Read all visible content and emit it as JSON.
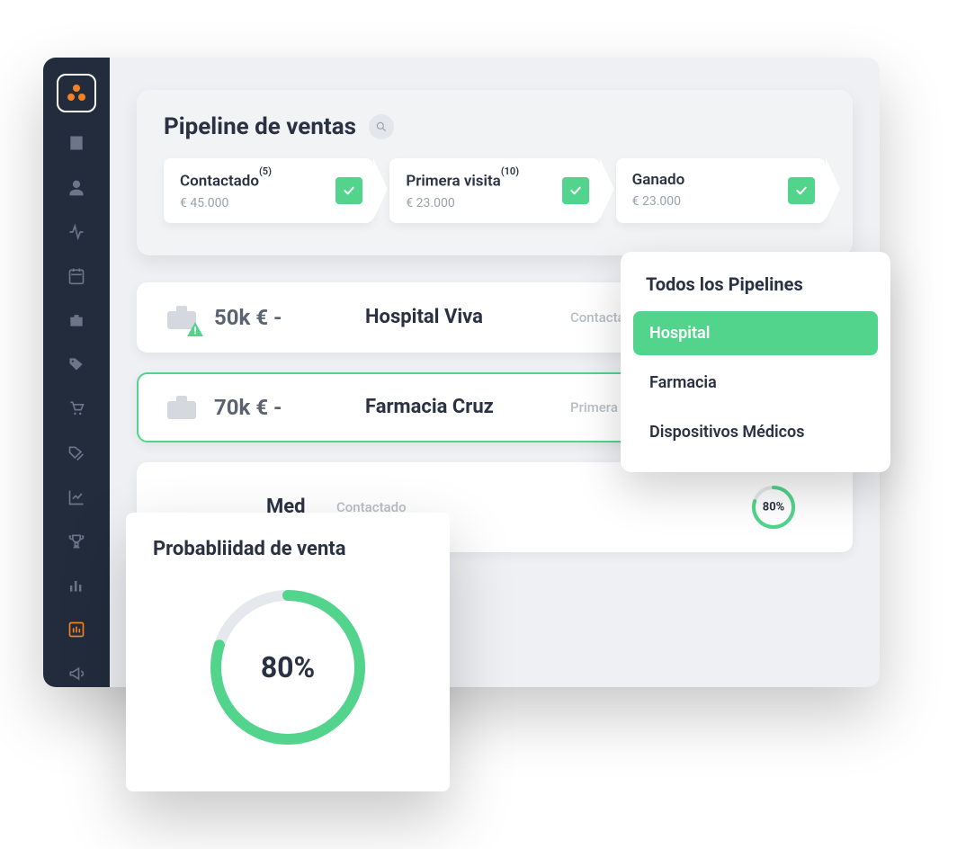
{
  "pipeline": {
    "title": "Pipeline de ventas",
    "stages": [
      {
        "label": "Contactado",
        "sup": "(5)",
        "amount": "€ 45.000"
      },
      {
        "label": "Primera visita",
        "sup": "(10)",
        "amount": "€ 23.000"
      },
      {
        "label": "Ganado",
        "sup": "",
        "amount": "€ 23.000"
      }
    ]
  },
  "deals": [
    {
      "amount": "50k € -",
      "name": "Hospital Viva",
      "status": "Contactado",
      "warn": true
    },
    {
      "amount": "70k € -",
      "name": "Farmacia Cruz",
      "status": "Primera Visita",
      "selected": true
    },
    {
      "amount": "",
      "name_suffix": "Med",
      "status": "Contactado",
      "pct": "80%"
    }
  ],
  "dropdown": {
    "title": "Todos los Pipelines",
    "items": [
      {
        "label": "Hospital",
        "selected": true
      },
      {
        "label": "Farmacia"
      },
      {
        "label": "Dispositivos Médicos"
      }
    ]
  },
  "probability": {
    "title": "Probabliidad de venta",
    "pct_label": "80%",
    "pct_value": 80
  },
  "colors": {
    "accent_green": "#52d48c",
    "accent_orange": "#f58220",
    "sidebar_bg": "#222c3c"
  }
}
